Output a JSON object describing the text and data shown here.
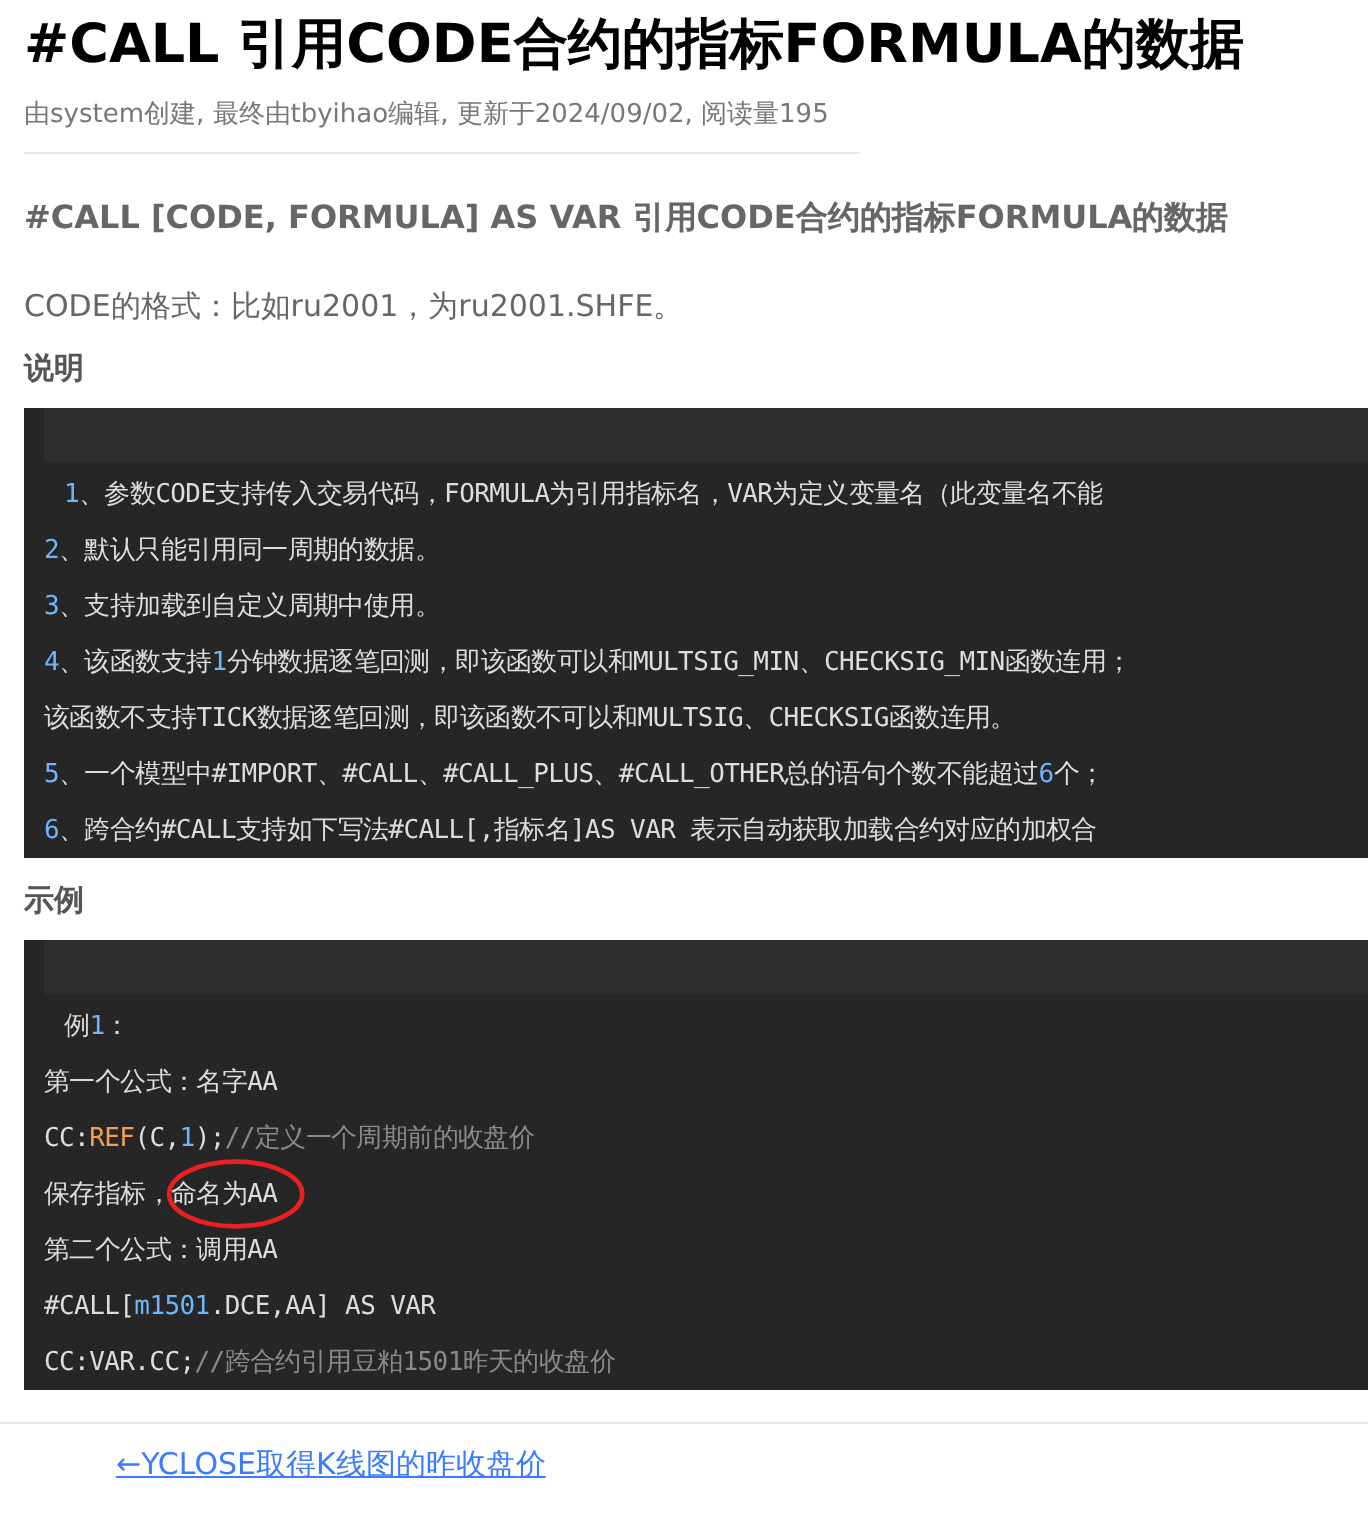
{
  "title": "#CALL 引用CODE合约的指标FORMULA的数据",
  "meta": "由system创建, 最终由tbyihao编辑, 更新于2024/09/02, 阅读量195",
  "subtitle": "#CALL [CODE, FORMULA] AS VAR 引用CODE合约的指标FORMULA的数据",
  "format_text": "CODE的格式：比如ru2001，为ru2001.SHFE。",
  "sections": [
    {
      "heading": "说明",
      "lines": [
        {
          "circled": false,
          "tokens": [
            {
              "kind": "num",
              "text": "1"
            },
            {
              "kind": "plain",
              "text": "、参数CODE支持传入交易代码，FORMULA为引用指标名，VAR为定义变量名（此变量名不能"
            }
          ]
        },
        {
          "circled": false,
          "tokens": [
            {
              "kind": "num",
              "text": "2"
            },
            {
              "kind": "plain",
              "text": "、默认只能引用同一周期的数据。"
            }
          ]
        },
        {
          "circled": false,
          "tokens": [
            {
              "kind": "num",
              "text": "3"
            },
            {
              "kind": "plain",
              "text": "、支持加载到自定义周期中使用。"
            }
          ]
        },
        {
          "circled": false,
          "tokens": [
            {
              "kind": "num",
              "text": "4"
            },
            {
              "kind": "plain",
              "text": "、该函数支持"
            },
            {
              "kind": "num",
              "text": "1"
            },
            {
              "kind": "plain",
              "text": "分钟数据逐笔回测，即该函数可以和MULTSIG_MIN、CHECKSIG_MIN函数连用；"
            }
          ]
        },
        {
          "circled": false,
          "tokens": [
            {
              "kind": "plain",
              "text": "该函数不支持TICK数据逐笔回测，即该函数不可以和MULTSIG、CHECKSIG函数连用。"
            }
          ]
        },
        {
          "circled": false,
          "tokens": [
            {
              "kind": "num",
              "text": "5"
            },
            {
              "kind": "plain",
              "text": "、一个模型中#IMPORT、#CALL、#CALL_PLUS、#CALL_OTHER总的语句个数不能超过"
            },
            {
              "kind": "num",
              "text": "6"
            },
            {
              "kind": "plain",
              "text": "个；"
            }
          ]
        },
        {
          "circled": false,
          "tokens": [
            {
              "kind": "num",
              "text": "6"
            },
            {
              "kind": "plain",
              "text": "、跨合约#CALL支持如下写法#CALL[,指标名]AS VAR 表示自动获取加载合约对应的加权合"
            }
          ]
        }
      ]
    },
    {
      "heading": "示例",
      "lines": [
        {
          "circled": false,
          "tokens": [
            {
              "kind": "plain",
              "text": "例"
            },
            {
              "kind": "num",
              "text": "1"
            },
            {
              "kind": "plain",
              "text": "："
            }
          ]
        },
        {
          "circled": false,
          "tokens": [
            {
              "kind": "plain",
              "text": "第一个公式：名字AA"
            }
          ]
        },
        {
          "circled": false,
          "tokens": [
            {
              "kind": "plain",
              "text": "CC:"
            },
            {
              "kind": "func",
              "text": "REF"
            },
            {
              "kind": "plain",
              "text": "(C,"
            },
            {
              "kind": "num",
              "text": "1"
            },
            {
              "kind": "plain",
              "text": ");"
            },
            {
              "kind": "comment",
              "text": "//定义一个周期前的收盘价"
            }
          ]
        },
        {
          "circled": true,
          "tokens": [
            {
              "kind": "plain",
              "text": "保存指标，命名为AA"
            }
          ]
        },
        {
          "circled": false,
          "tokens": [
            {
              "kind": "plain",
              "text": "第二个公式：调用AA"
            }
          ]
        },
        {
          "circled": false,
          "tokens": [
            {
              "kind": "plain",
              "text": "#CALL["
            },
            {
              "kind": "num",
              "text": "m1501"
            },
            {
              "kind": "plain",
              "text": ".DCE,AA] AS VAR"
            }
          ]
        },
        {
          "circled": false,
          "tokens": [
            {
              "kind": "plain",
              "text": "CC:VAR.CC;"
            },
            {
              "kind": "comment",
              "text": "//跨合约引用豆粕1501昨天的收盘价"
            }
          ]
        }
      ]
    }
  ],
  "prev_link": "←YCLOSE取得K线图的昨收盘价"
}
